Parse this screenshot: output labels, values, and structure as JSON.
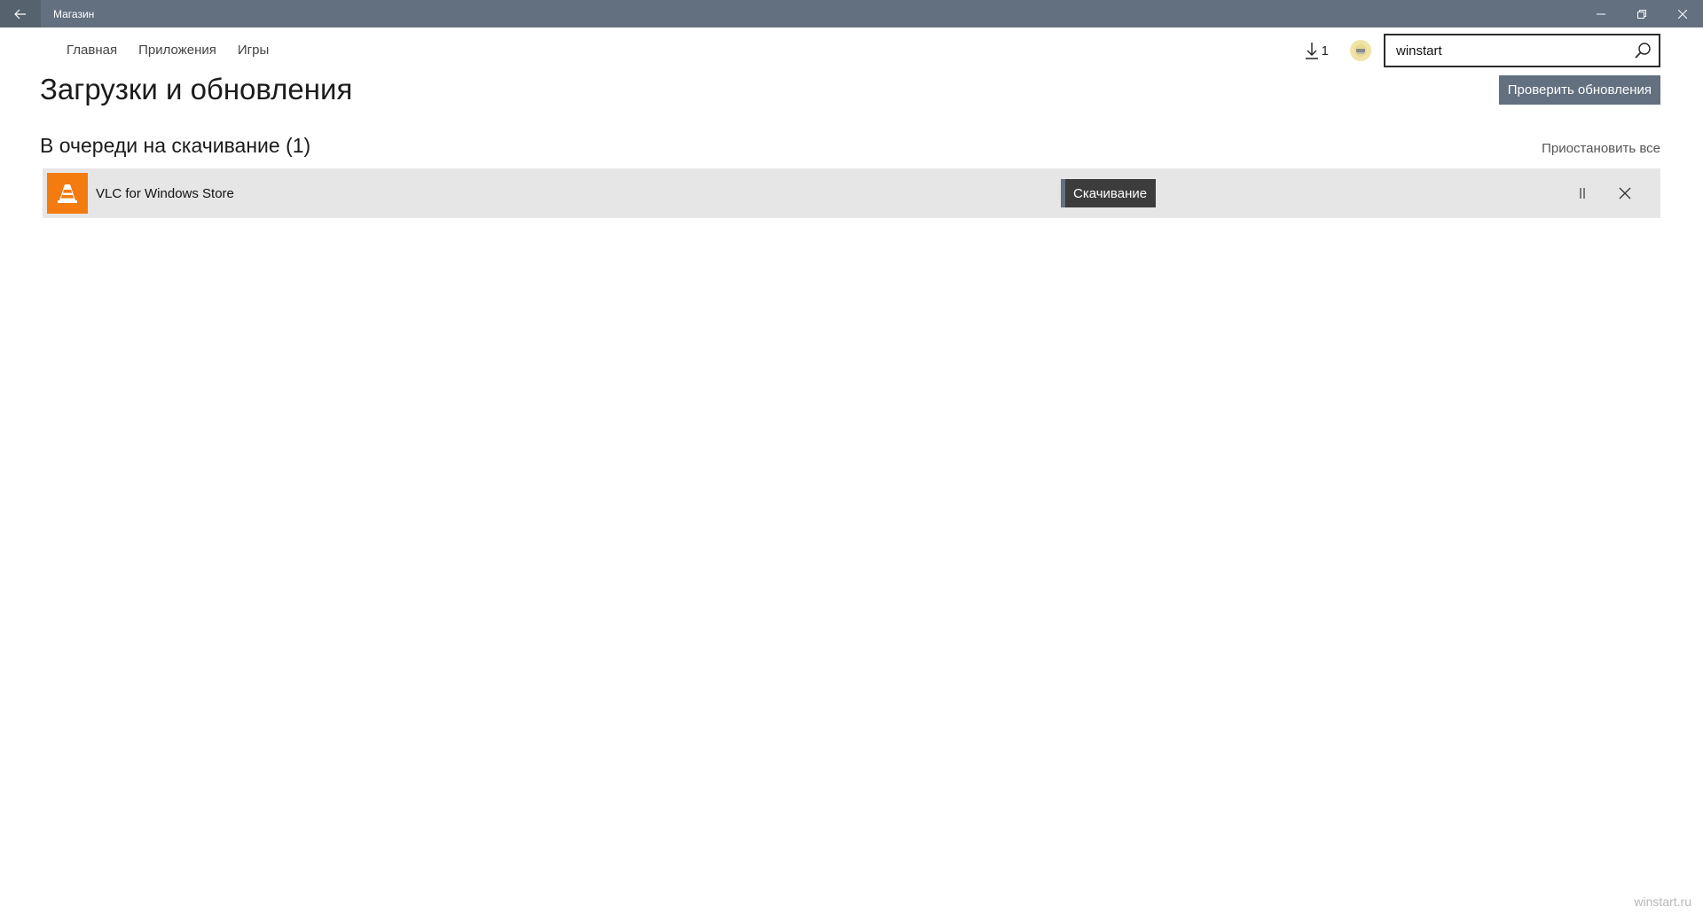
{
  "titlebar": {
    "title": "Магазин",
    "back_icon": "arrow-left-icon",
    "controls": [
      "minimize-icon",
      "restore-icon",
      "close-icon"
    ]
  },
  "nav": {
    "items": [
      {
        "label": "Главная"
      },
      {
        "label": "Приложения"
      },
      {
        "label": "Игры"
      }
    ]
  },
  "toolbar": {
    "downloads_count": "1",
    "download_icon": "download-icon",
    "search_value": "winstart",
    "search_icon": "search-icon"
  },
  "page": {
    "title": "Загрузки и обновления",
    "check_updates_label": "Проверить обновления"
  },
  "queue": {
    "section_title": "В очереди на скачивание (1)",
    "pause_all_label": "Приостановить все",
    "items": [
      {
        "name": "VLC for Windows Store",
        "status": "Скачивание",
        "tile_color": "#f47b10",
        "icon": "vlc-cone-icon"
      }
    ]
  },
  "colors": {
    "accent": "#627080",
    "row_bg": "#e6e6e6"
  },
  "watermark": "winstart.ru"
}
